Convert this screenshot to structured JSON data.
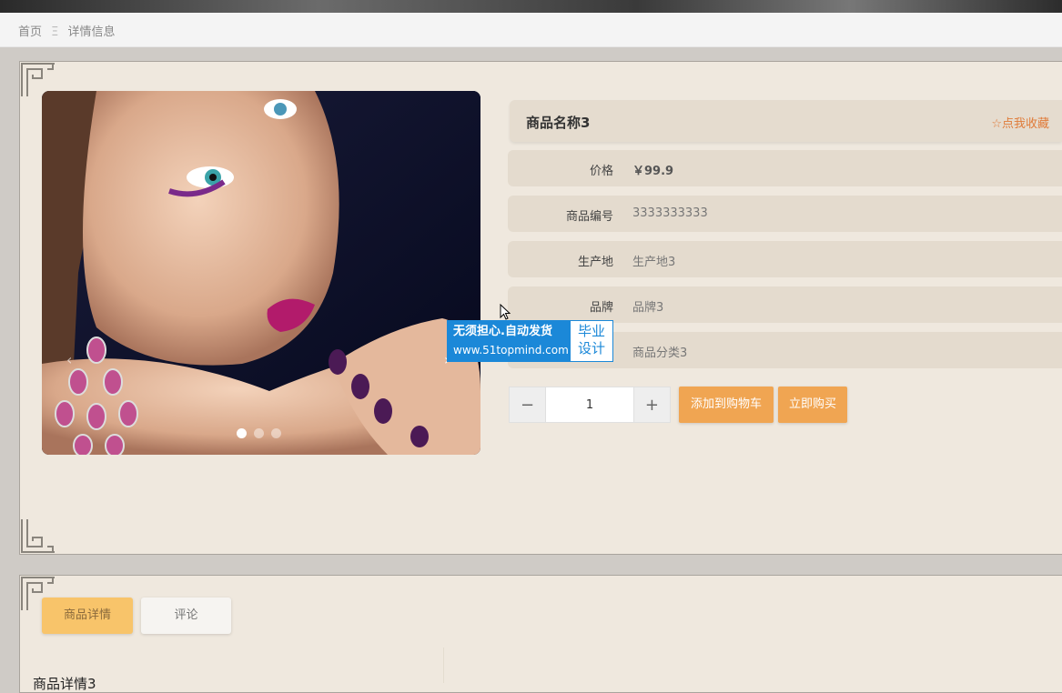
{
  "breadcrumb": {
    "home": "首页",
    "separator": "Ξ",
    "current": "详情信息"
  },
  "product": {
    "name": "商品名称3",
    "favorite_label": "☆点我收藏",
    "fields": [
      {
        "label": "价格",
        "value": "￥99.9"
      },
      {
        "label": "商品编号",
        "value": "3333333333"
      },
      {
        "label": "生产地",
        "value": "生产地3"
      },
      {
        "label": "品牌",
        "value": "品牌3"
      },
      {
        "label": "",
        "value": "商品分类3"
      }
    ]
  },
  "carousel": {
    "slide_count": 3,
    "active_slide": 1,
    "prev_icon": "‹",
    "next_icon": "›"
  },
  "quantity": {
    "minus": "−",
    "value": "1",
    "plus": "+"
  },
  "actions": {
    "add_to_cart": "添加到购物车",
    "buy_now": "立即购买"
  },
  "watermark": {
    "line1": "无须担心.自动发货",
    "line2": "www.51topmind.com",
    "tag_line1": "毕业",
    "tag_line2": "设计"
  },
  "tabs": [
    {
      "label": "商品详情"
    },
    {
      "label": "评论"
    }
  ],
  "detail": {
    "heading": "商品详情3"
  },
  "colors": {
    "accent_orange": "#f0a552",
    "favorite": "#e07b39",
    "panel_bg": "#efe8de",
    "watermark_blue": "#1b88d8"
  }
}
